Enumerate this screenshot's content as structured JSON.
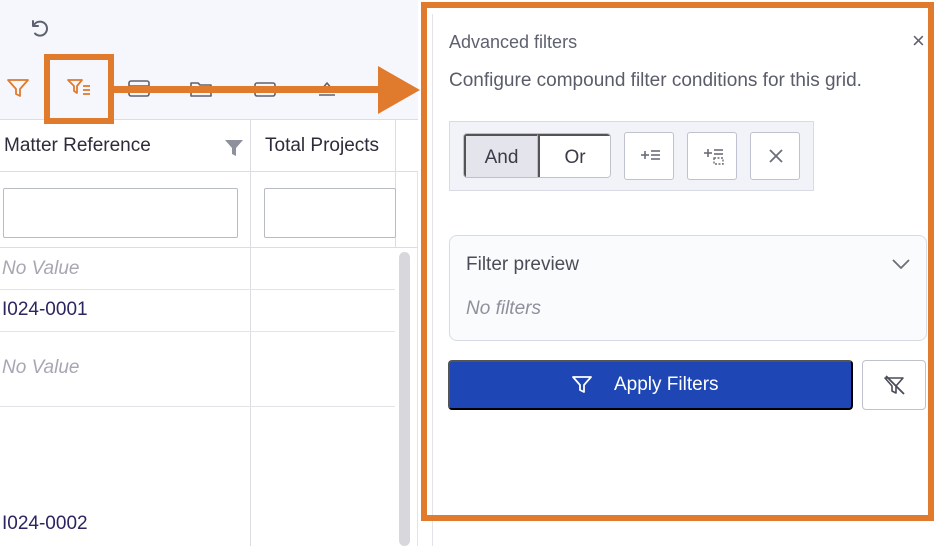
{
  "grid": {
    "columns": [
      "Matter Reference",
      "Total Projects"
    ],
    "rows": [
      {
        "matter_reference": "No Value",
        "empty": true
      },
      {
        "matter_reference": "I024-0001",
        "empty": false
      },
      {
        "matter_reference": "No Value",
        "empty": true
      },
      {
        "matter_reference": "I024-0002",
        "empty": false
      }
    ]
  },
  "toolbar": {
    "icons": [
      "undo-icon",
      "filter-icon",
      "advanced-filter-icon",
      "layout-icon",
      "folder-icon",
      "tag-icon",
      "export-icon"
    ]
  },
  "advanced_filters": {
    "title": "Advanced filters",
    "close_label": "×",
    "description": "Configure compound filter conditions for this grid.",
    "logic_and": "And",
    "logic_or": "Or",
    "preview_title": "Filter preview",
    "preview_empty": "No filters",
    "apply_label": "Apply Filters"
  },
  "colors": {
    "highlight": "#e07a2c",
    "primary": "#1e46b4",
    "filter_icon": "#e07a2c"
  }
}
